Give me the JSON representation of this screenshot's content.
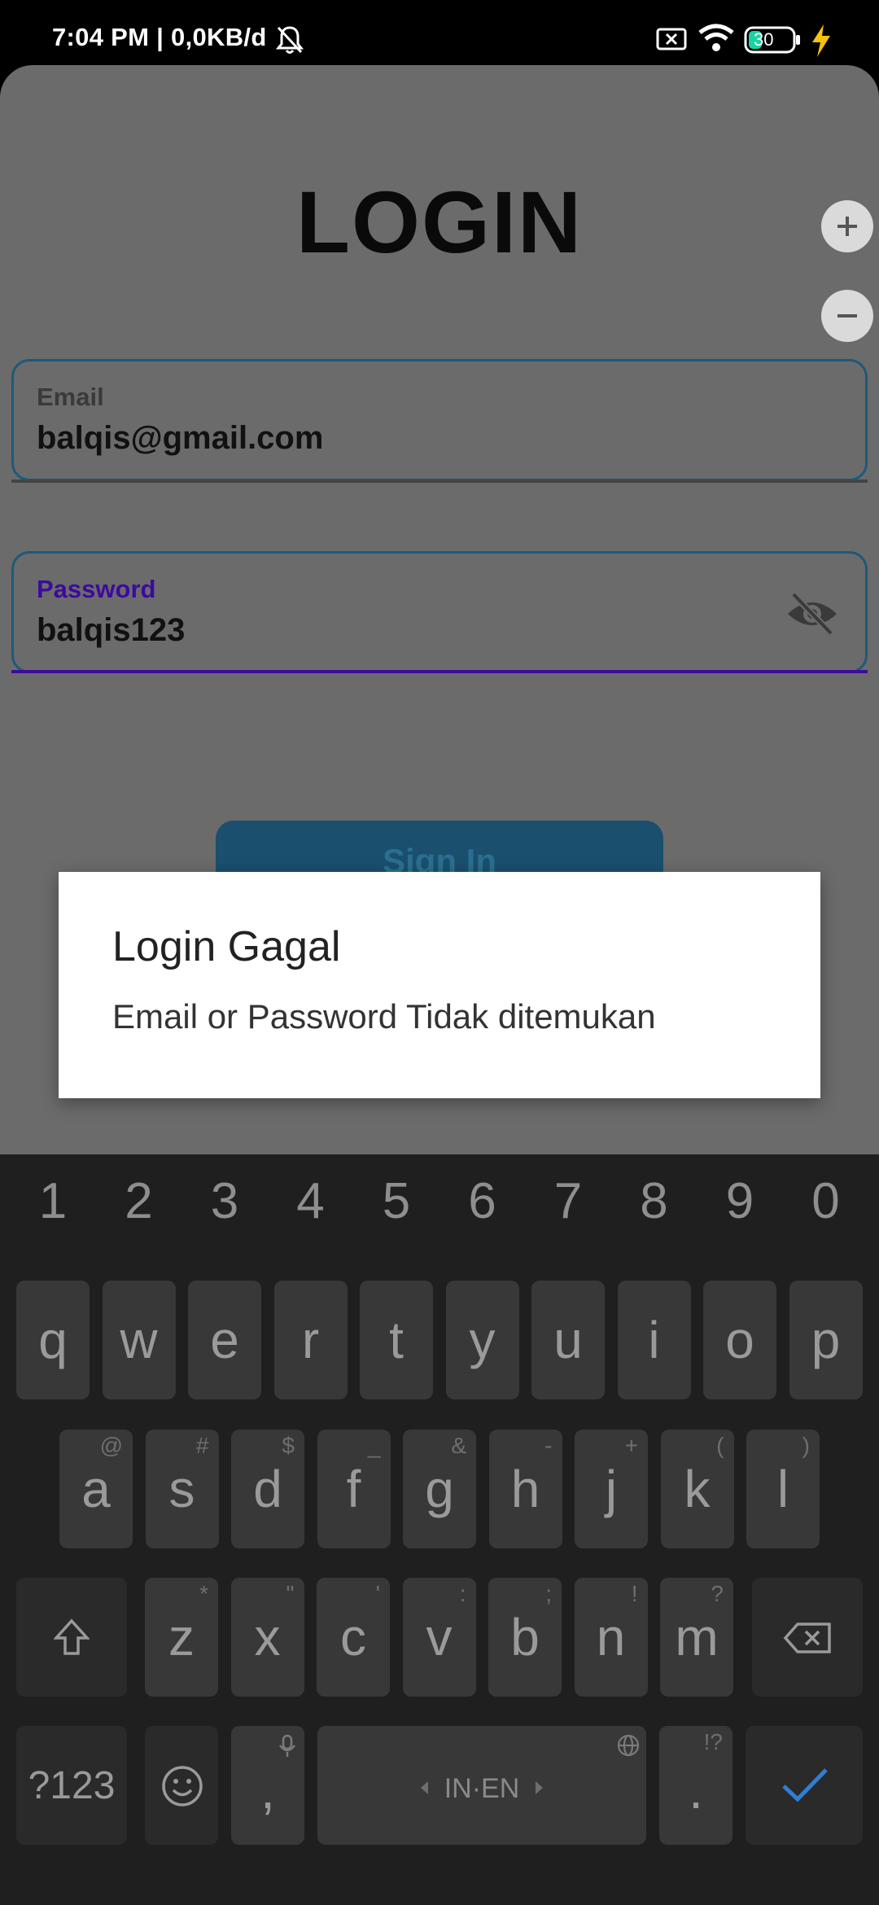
{
  "status_bar": {
    "time": "7:04 PM | 0,0KB/d",
    "battery_level": "30"
  },
  "screen": {
    "title": "LOGIN",
    "zoom_in_label": "+",
    "zoom_out_label": "−"
  },
  "form": {
    "email": {
      "label": "Email",
      "value": "balqis@gmail.com"
    },
    "password": {
      "label": "Password",
      "value": "balqis123"
    },
    "signin_label": "Sign In"
  },
  "dialog": {
    "title": "Login Gagal",
    "message": "Email or Password Tidak ditemukan"
  },
  "keyboard": {
    "numbers": [
      "1",
      "2",
      "3",
      "4",
      "5",
      "6",
      "7",
      "8",
      "9",
      "0"
    ],
    "row1": [
      "q",
      "w",
      "e",
      "r",
      "t",
      "y",
      "u",
      "i",
      "o",
      "p"
    ],
    "row2": [
      "a",
      "s",
      "d",
      "f",
      "g",
      "h",
      "j",
      "k",
      "l"
    ],
    "row2_hints": [
      "@",
      "#",
      "$",
      "_",
      "&",
      "-",
      "+",
      "(",
      ")"
    ],
    "row3": [
      "z",
      "x",
      "c",
      "v",
      "b",
      "n",
      "m"
    ],
    "row3_hints": [
      "*",
      "\"",
      "'",
      ":",
      ";",
      "!",
      "?"
    ],
    "symbols_key": "?123",
    "comma_key": ",",
    "space_label": "IN·EN",
    "period_key": ".",
    "period_hint": "!?"
  },
  "colors": {
    "accent_purple": "#3d0a9e",
    "field_border": "#1c5a7a"
  }
}
